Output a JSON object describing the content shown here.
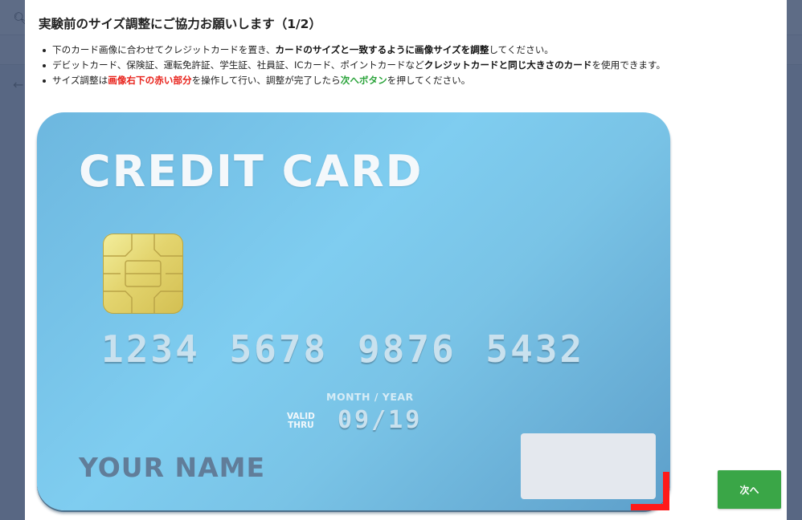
{
  "modal": {
    "title": "実験前のサイズ調整にご協力お願いします（1/2）",
    "instructions": [
      {
        "a": "下のカード画像に合わせてクレジットカードを置き、",
        "b": "カードのサイズと一致するように画像サイズを調整",
        "c": "してください。"
      },
      {
        "a": "デビットカード、保険証、運転免許証、学生証、社員証、ICカード、ポイントカードなど",
        "b": "クレジットカードと同じ大きさのカード",
        "c": "を使用できます。"
      },
      {
        "a": "サイズ調整は",
        "b": "画像右下の赤い部分",
        "c": "を操作して行い、調整が完了したら",
        "d": "次へボタン",
        "e": "を押してください。"
      }
    ],
    "next_label": "次へ"
  },
  "card": {
    "title": "CREDIT CARD",
    "number": "1234 5678 9876 5432",
    "month_year": "MONTH / YEAR",
    "valid": "VALID",
    "thru": "THRU",
    "expiry": "09/19",
    "holder": "YOUR NAME"
  },
  "colors": {
    "resize_handle": "#ff1a1a",
    "next_button": "#3aa647",
    "emphasis_red": "#e8221b",
    "emphasis_green": "#2aa33a"
  }
}
